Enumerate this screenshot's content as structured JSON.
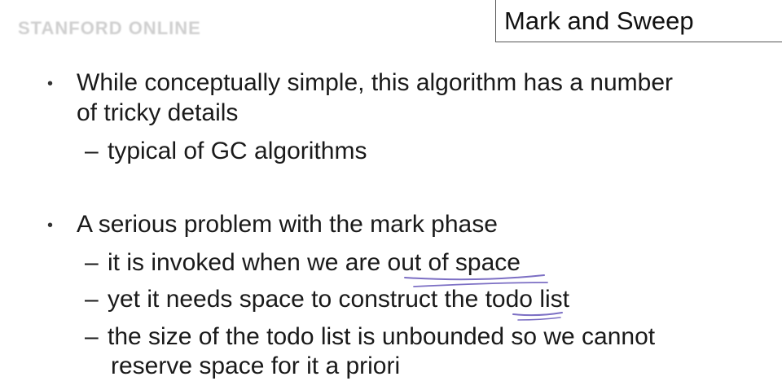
{
  "logo": {
    "text": "STANFORD ONLINE"
  },
  "slide": {
    "title": "Mark and Sweep",
    "bullet1": {
      "line1": "While conceptually simple, this algorithm has a number",
      "line2": "of tricky details",
      "sub1": "typical of GC algorithms"
    },
    "bullet2": {
      "text": "A serious problem with the mark phase",
      "sub1_pre": "it is invoked when we are ",
      "sub1_emph": "out of space",
      "sub2_pre": "yet it needs space to construct the ",
      "sub2_emph": "todo",
      "sub2_post": " list",
      "sub3_line1": "the size of the todo list is unbounded so we cannot",
      "sub3_line2": "reserve space for it a priori"
    },
    "bullet_symbol": "•",
    "dash_symbol": "–"
  },
  "colors": {
    "annotation_ink": "#7c6fc4"
  }
}
